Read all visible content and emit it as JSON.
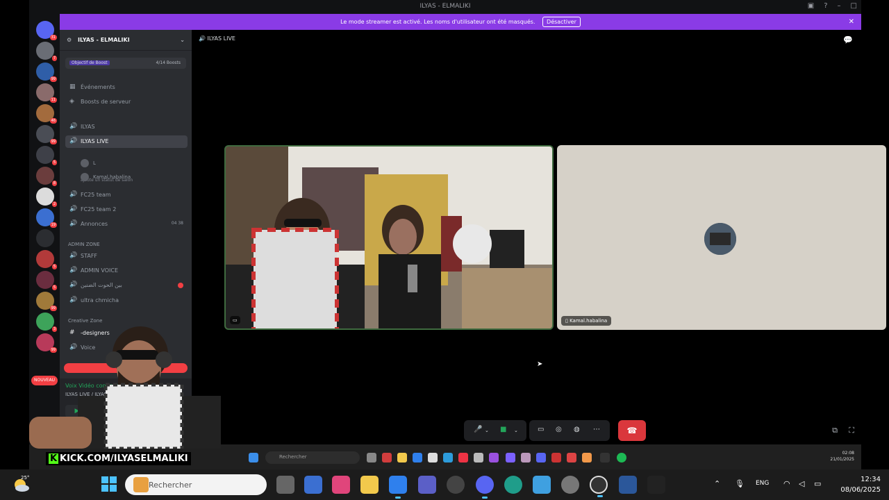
{
  "window": {
    "title": "ILYAS - ELMALIKI"
  },
  "banner": {
    "text": "Le mode streamer est activé. Les noms d'utilisateur ont été masqués.",
    "button": "Désactiver"
  },
  "server": {
    "name": "ILYAS - ELMALIKI",
    "boost_goal": "Objectif de Boost",
    "boost_count": "4/14 Boosts"
  },
  "sidebar": {
    "events": "Événements",
    "server_boosts": "Boosts de serveur",
    "channels": [
      {
        "label": "ILYAS",
        "icon": "speaker"
      },
      {
        "label": "ILYAS LIVE",
        "icon": "speaker"
      },
      {
        "label": "FC25 team",
        "icon": "speaker"
      },
      {
        "label": "FC25 team 2",
        "icon": "speaker"
      },
      {
        "label": "Annonces",
        "icon": "speaker",
        "count": "04  38"
      }
    ],
    "live_subtitle": "ajoute un statut de salon",
    "members": [
      "L",
      "Kamal.habalina"
    ],
    "category1": "ADMIN ZONE",
    "admin_channels": [
      "STAFF",
      "ADMIN VOICE",
      "بين الحوت الضنين",
      "ultra chmicha"
    ],
    "category2": "Creative Zone",
    "creative_channels": [
      "-designers",
      "Voice"
    ],
    "new_badge": "NOUVEAU"
  },
  "voice_panel": {
    "status": "Voix Vidéo connectée",
    "location": "ILYAS LIVE / ILYAS"
  },
  "call": {
    "channel": "ILYAS LIVE",
    "participant2": "Kamal.habalina"
  },
  "inner_taskbar": {
    "search": "Rechercher",
    "time": "02:08",
    "date": "21/01/2025"
  },
  "overlay": {
    "kick": "KICK.COM/ILYASELMALIKI"
  },
  "taskbar": {
    "temp": "25°",
    "search_placeholder": "Rechercher",
    "lang": "ENG",
    "time": "12:34",
    "date": "08/06/2025"
  },
  "colors": {
    "banner": "#8a3be6",
    "hangup": "#da373c",
    "accent_green": "#23a55a"
  }
}
